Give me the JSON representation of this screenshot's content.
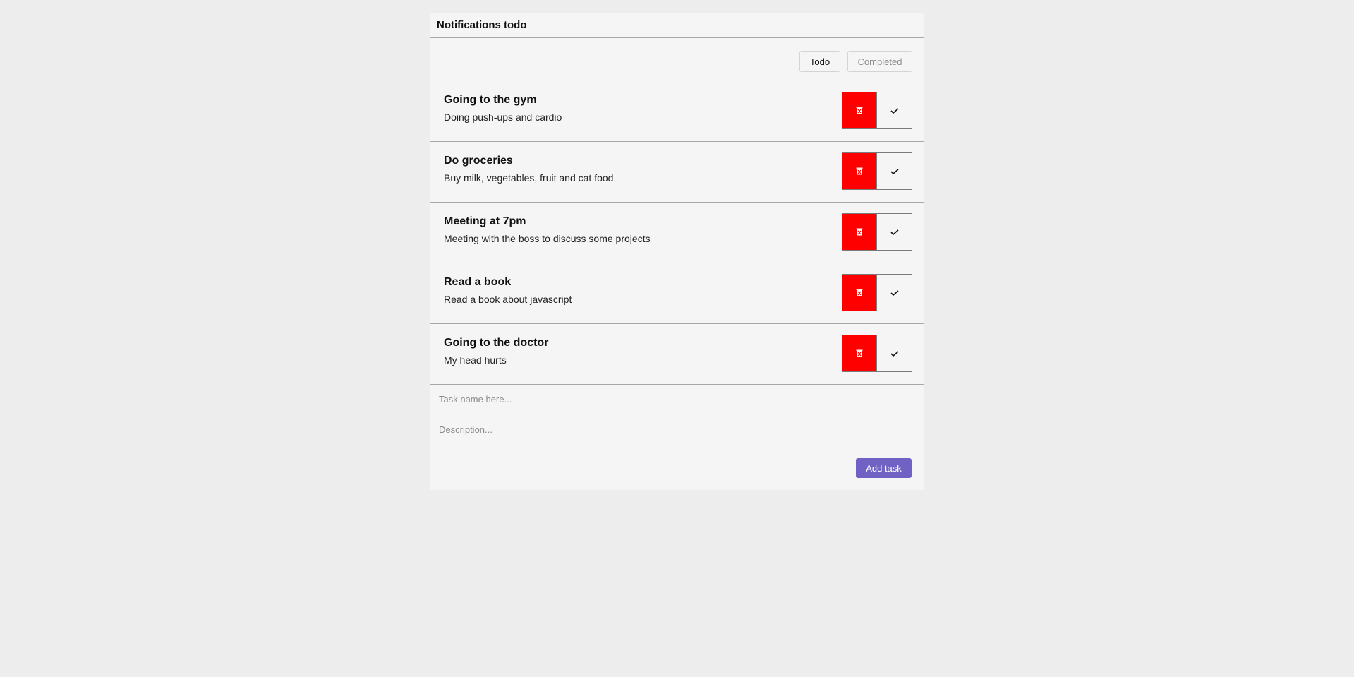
{
  "header": {
    "title": "Notifications todo"
  },
  "filters": {
    "todo_label": "Todo",
    "completed_label": "Completed"
  },
  "tasks": [
    {
      "title": "Going to the gym",
      "description": "Doing push-ups and cardio"
    },
    {
      "title": "Do groceries",
      "description": "Buy milk, vegetables, fruit and cat food"
    },
    {
      "title": "Meeting at 7pm",
      "description": "Meeting with the boss to discuss some projects"
    },
    {
      "title": "Read a book",
      "description": "Read a book about javascript"
    },
    {
      "title": "Going to the doctor",
      "description": "My head hurts"
    }
  ],
  "form": {
    "name_placeholder": "Task name here...",
    "description_placeholder": "Description...",
    "add_label": "Add task"
  },
  "icons": {
    "delete": "trash-icon",
    "complete": "checkmark-icon"
  },
  "colors": {
    "delete": "#ff0000",
    "accent": "#6f62c4"
  }
}
